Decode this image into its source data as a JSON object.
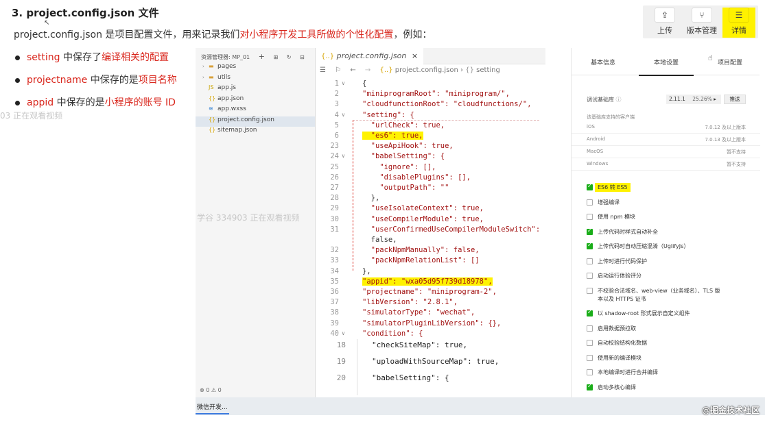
{
  "slide": {
    "title": "3. project.config.json 文件",
    "desc_plain": "project.config.json 是项目配置文件，用来记录我们",
    "desc_red": "对小程序开发工具所做的个性化配置",
    "desc_end": "，例如：",
    "bullets": [
      {
        "key": "setting",
        "mid": " 中保存了",
        "val": "编译相关的配置"
      },
      {
        "key": "projectname",
        "mid": " 中保存的是",
        "val": "项目名称"
      },
      {
        "key": "appid",
        "mid": " 中保存的是",
        "val": "小程序的账号 ID"
      }
    ],
    "watermark1": "03 正在观看视频",
    "watermark2": "学谷 334903 正在观看视频"
  },
  "toolbar": {
    "upload": "上传",
    "version": "版本管理",
    "detail": "详情"
  },
  "tree": {
    "header": "资源管理器: MP_01",
    "items": [
      {
        "label": "pages",
        "icon": "folder-icon",
        "arrow": "›"
      },
      {
        "label": "utils",
        "icon": "folder-icon",
        "arrow": "›"
      },
      {
        "label": "app.js",
        "icon": "js-icon",
        "arrow": ""
      },
      {
        "label": "app.json",
        "icon": "json-icon",
        "arrow": ""
      },
      {
        "label": "app.wxss",
        "icon": "wxss-icon",
        "arrow": ""
      },
      {
        "label": "project.config.json",
        "icon": "json-icon",
        "arrow": ""
      },
      {
        "label": "sitemap.json",
        "icon": "json-icon",
        "arrow": ""
      }
    ],
    "footer": "⊗ 0 ⚠ 0"
  },
  "editor": {
    "tab": "project.config.json",
    "crumb_file": "project.config.json",
    "crumb_node": "setting",
    "lines": [
      {
        "n": "1",
        "fold": "∨",
        "text": "{"
      },
      {
        "n": "2",
        "fold": "",
        "text": "\"miniprogramRoot\": \"miniprogram/\","
      },
      {
        "n": "3",
        "fold": "",
        "text": "\"cloudfunctionRoot\": \"cloudfunctions/\","
      },
      {
        "n": "4",
        "fold": "∨",
        "text": "\"setting\": {"
      },
      {
        "n": "5",
        "fold": "",
        "text": "  \"urlCheck\": true,"
      },
      {
        "n": "6",
        "fold": "",
        "text": "  \"es6\": true,"
      },
      {
        "n": "23",
        "fold": "",
        "text": "  \"useApiHook\": true,"
      },
      {
        "n": "24",
        "fold": "∨",
        "text": "  \"babelSetting\": {"
      },
      {
        "n": "25",
        "fold": "",
        "text": "    \"ignore\": [],"
      },
      {
        "n": "26",
        "fold": "",
        "text": "    \"disablePlugins\": [],"
      },
      {
        "n": "27",
        "fold": "",
        "text": "    \"outputPath\": \"\""
      },
      {
        "n": "28",
        "fold": "",
        "text": "  },"
      },
      {
        "n": "29",
        "fold": "",
        "text": "  \"useIsolateContext\": true,"
      },
      {
        "n": "30",
        "fold": "",
        "text": "  \"useCompilerModule\": true,"
      },
      {
        "n": "31",
        "fold": "",
        "text": "  \"userConfirmedUseCompilerModuleSwitch\":"
      },
      {
        "n": "",
        "fold": "",
        "text": "  false,"
      },
      {
        "n": "32",
        "fold": "",
        "text": "  \"packNpmManually\": false,"
      },
      {
        "n": "33",
        "fold": "",
        "text": "  \"packNpmRelationList\": []"
      },
      {
        "n": "34",
        "fold": "",
        "text": "},"
      },
      {
        "n": "35",
        "fold": "",
        "text": "\"appid\": \"wxa05d95f739d18978\","
      },
      {
        "n": "36",
        "fold": "",
        "text": "\"projectname\": \"miniprogram-2\","
      },
      {
        "n": "37",
        "fold": "",
        "text": "\"libVersion\": \"2.8.1\","
      },
      {
        "n": "38",
        "fold": "",
        "text": "\"simulatorType\": \"wechat\","
      },
      {
        "n": "39",
        "fold": "",
        "text": "\"simulatorPluginLibVersion\": {},"
      },
      {
        "n": "40",
        "fold": "∨",
        "text": "\"condition\": {"
      }
    ]
  },
  "code2": {
    "lines": [
      {
        "n": "18",
        "text": "\"checkSiteMap\": true,"
      },
      {
        "n": "19",
        "text": "\"uploadWithSourceMap\": true,"
      },
      {
        "n": "20",
        "text": "\"babelSetting\": {"
      }
    ]
  },
  "settings": {
    "tabs": [
      "基本信息",
      "本地设置",
      "项目配置"
    ],
    "lib_label": "调试基础库",
    "lib_version": "2.11.1",
    "lib_percent": "25.26%",
    "push": "推送",
    "compat_label": "该基础库支持的客户端",
    "platforms": [
      {
        "name": "iOS",
        "value": "7.0.12 及以上版本"
      },
      {
        "name": "Android",
        "value": "7.0.13 及以上版本"
      },
      {
        "name": "MacOS",
        "value": "暂不支持"
      },
      {
        "name": "Windows",
        "value": "暂不支持"
      }
    ],
    "options": [
      {
        "label": "ES6 转 ES5",
        "checked": true,
        "highlight": true
      },
      {
        "label": "增强编译",
        "checked": false
      },
      {
        "label": "使用 npm 模块",
        "checked": false
      },
      {
        "label": "上传代码时样式自动补全",
        "checked": true
      },
      {
        "label": "上传代码时自动压缩混淆（UglifyJs）",
        "checked": true
      },
      {
        "label": "上传时进行代码保护",
        "checked": false
      },
      {
        "label": "启动运行体验评分",
        "checked": false
      },
      {
        "label": "不校验合法域名、web-view（业务域名）、TLS 版",
        "label2": "本以及 HTTPS 证书",
        "checked": false
      },
      {
        "label": "以 shadow-root 形式展示自定义组件",
        "checked": true
      },
      {
        "label": "启用数据预拉取",
        "checked": false
      },
      {
        "label": "自动校验结构化数据",
        "checked": false
      },
      {
        "label": "使用新的编译模块",
        "checked": false
      },
      {
        "label": "本地编译时进行合并编译",
        "checked": false
      },
      {
        "label": "启动多核心编译",
        "checked": true
      }
    ]
  },
  "bottombar": {
    "task": "微信开发...",
    "brand": "@掘金技术社区"
  }
}
